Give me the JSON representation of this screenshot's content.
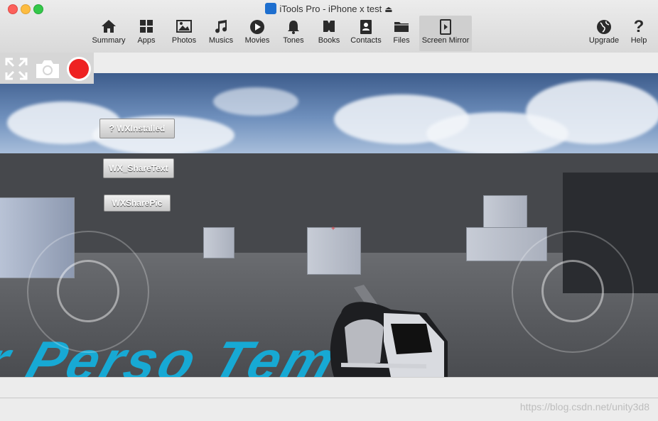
{
  "window": {
    "title": "iTools Pro - iPhone x test"
  },
  "toolbar": {
    "items": [
      {
        "label": "Summary",
        "icon": "home-icon"
      },
      {
        "label": "Apps",
        "icon": "apps-grid-icon"
      },
      {
        "label": "Photos",
        "icon": "photo-icon"
      },
      {
        "label": "Musics",
        "icon": "music-note-icon"
      },
      {
        "label": "Movies",
        "icon": "play-circle-icon"
      },
      {
        "label": "Tones",
        "icon": "bell-icon"
      },
      {
        "label": "Books",
        "icon": "book-icon"
      },
      {
        "label": "Contacts",
        "icon": "contacts-icon"
      },
      {
        "label": "Files",
        "icon": "folder-icon"
      },
      {
        "label": "Screen Mirror",
        "icon": "screen-mirror-icon",
        "active": true
      }
    ],
    "right_items": [
      {
        "label": "Upgrade",
        "icon": "globe-icon"
      },
      {
        "label": "Help",
        "icon": "question-icon"
      }
    ]
  },
  "mirror_controls": [
    "fullscreen-icon",
    "camera-icon",
    "record-icon"
  ],
  "game": {
    "buttons": [
      "? WXInstalled",
      "WX_ShareText",
      "WXSharePic"
    ],
    "floor_text": "r Perso   Tem"
  },
  "watermark": "https://blog.csdn.net/unity3d8",
  "colors": {
    "record": "#ee2222",
    "floor_text": "#17a9d4",
    "active_tab": "#cfcfcf"
  }
}
